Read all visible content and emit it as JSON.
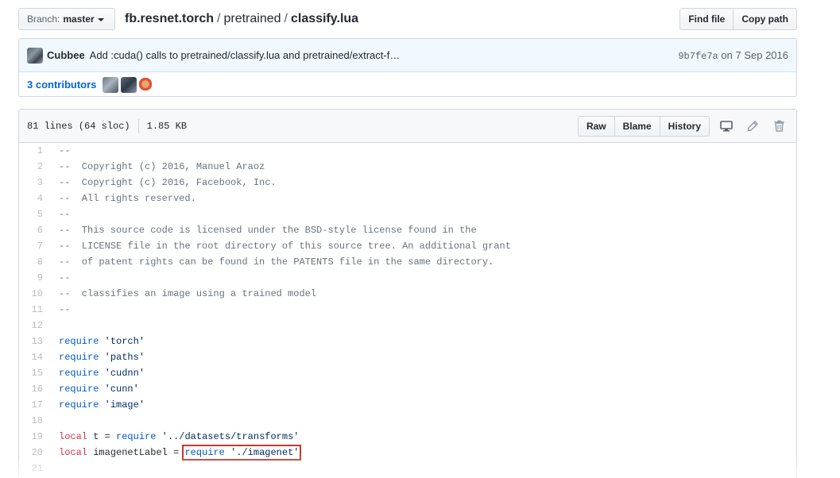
{
  "nav": {
    "branch_label": "Branch:",
    "branch_value": "master",
    "repo": "fb.resnet.torch",
    "sep1": "/",
    "folder": "pretrained",
    "sep2": "/",
    "file": "classify.lua",
    "find_file": "Find file",
    "copy_path": "Copy path"
  },
  "commit": {
    "author": "Cubbee",
    "message": "Add :cuda() calls to pretrained/classify.lua and pretrained/extract-f…",
    "sha": "9b7fe7a",
    "date_prefix": "on",
    "date": "7 Sep 2016"
  },
  "contributors": {
    "count_text": "3 contributors"
  },
  "file_header": {
    "lines": "81 lines (64 sloc)",
    "size": "1.85 KB",
    "raw": "Raw",
    "blame": "Blame",
    "history": "History"
  },
  "code_lines": [
    {
      "n": "1",
      "text": "--"
    },
    {
      "n": "2",
      "text": "--  Copyright (c) 2016, Manuel Araoz"
    },
    {
      "n": "3",
      "text": "--  Copyright (c) 2016, Facebook, Inc."
    },
    {
      "n": "4",
      "text": "--  All rights reserved."
    },
    {
      "n": "5",
      "text": "--"
    },
    {
      "n": "6",
      "text": "--  This source code is licensed under the BSD-style license found in the"
    },
    {
      "n": "7",
      "text": "--  LICENSE file in the root directory of this source tree. An additional grant"
    },
    {
      "n": "8",
      "text": "--  of patent rights can be found in the PATENTS file in the same directory."
    },
    {
      "n": "9",
      "text": "--"
    },
    {
      "n": "10",
      "text": "--  classifies an image using a trained model"
    },
    {
      "n": "11",
      "text": "--"
    },
    {
      "n": "12",
      "text": ""
    },
    {
      "n": "13",
      "text": "require 'torch'"
    },
    {
      "n": "14",
      "text": "require 'paths'"
    },
    {
      "n": "15",
      "text": "require 'cudnn'"
    },
    {
      "n": "16",
      "text": "require 'cunn'"
    },
    {
      "n": "17",
      "text": "require 'image'"
    },
    {
      "n": "18",
      "text": ""
    },
    {
      "n": "19",
      "text": "local t = require '../datasets/transforms'"
    },
    {
      "n": "20",
      "text": "local imagenetLabel = require './imagenet'",
      "highlight": "require './imagenet'"
    },
    {
      "n": "21",
      "text": ""
    }
  ],
  "colors": {
    "highlight_box": "#c0392b",
    "link": "#0366d6",
    "commit_bg": "#f1f8ff"
  },
  "icons": [
    "caret-down-icon",
    "desktop-icon",
    "pencil-icon",
    "trash-icon"
  ]
}
